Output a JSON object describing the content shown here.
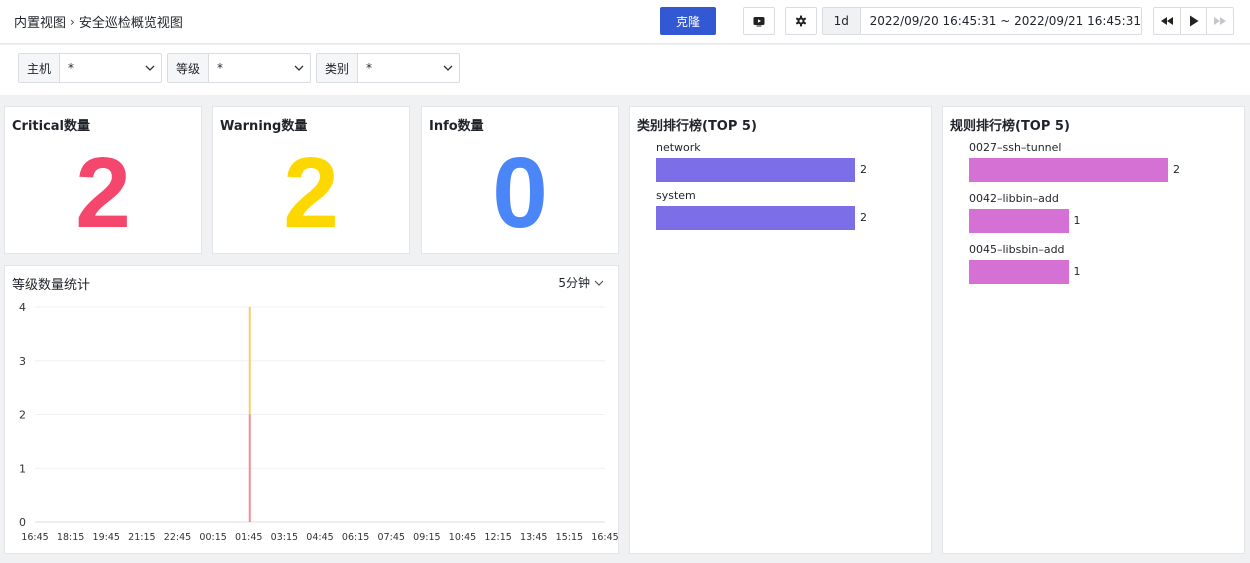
{
  "header": {
    "breadcrumb_root": "内置视图",
    "breadcrumb_current": "安全巡检概览视图",
    "clone_label": "克隆",
    "quick_range": "1d",
    "time_range": "2022/09/20 16:45:31 ~ 2022/09/21 16:45:31"
  },
  "filters": [
    {
      "label": "主机",
      "value": "*"
    },
    {
      "label": "等级",
      "value": "*"
    },
    {
      "label": "类别",
      "value": "*"
    }
  ],
  "stats": {
    "critical": {
      "title": "Critical数量",
      "value": "2",
      "color": "#f5476d"
    },
    "warning": {
      "title": "Warning数量",
      "value": "2",
      "color": "#fdd800"
    },
    "info": {
      "title": "Info数量",
      "value": "0",
      "color": "#4a86f7"
    }
  },
  "category_rank": {
    "title": "类别排行榜(TOP 5)",
    "color": "#7b6ee6",
    "items": [
      {
        "label": "network",
        "value": 2
      },
      {
        "label": "system",
        "value": 2
      }
    ]
  },
  "rule_rank": {
    "title": "规则排行榜(TOP 5)",
    "color": "#d570d5",
    "items": [
      {
        "label": "0027–ssh–tunnel",
        "value": 2
      },
      {
        "label": "0042–libbin–add",
        "value": 1
      },
      {
        "label": "0045–libsbin–add",
        "value": 1
      }
    ]
  },
  "level_chart": {
    "title": "等级数量统计",
    "interval": "5分钟"
  },
  "chart_data": {
    "type": "bar",
    "x": [
      "16:45",
      "18:15",
      "19:45",
      "21:15",
      "22:45",
      "00:15",
      "01:45",
      "03:15",
      "04:45",
      "06:15",
      "07:45",
      "09:15",
      "10:45",
      "12:15",
      "13:45",
      "15:15",
      "16:45"
    ],
    "ylim": [
      0,
      4
    ],
    "yticks": [
      0,
      1,
      2,
      3,
      4
    ],
    "series": [
      {
        "color": "#f48a9a",
        "points": [
          {
            "x": "01:45",
            "y": 2
          }
        ]
      },
      {
        "color": "#f8cc6e",
        "stacked_on_previous": true,
        "points": [
          {
            "x": "01:45",
            "y": 2
          }
        ]
      }
    ]
  }
}
